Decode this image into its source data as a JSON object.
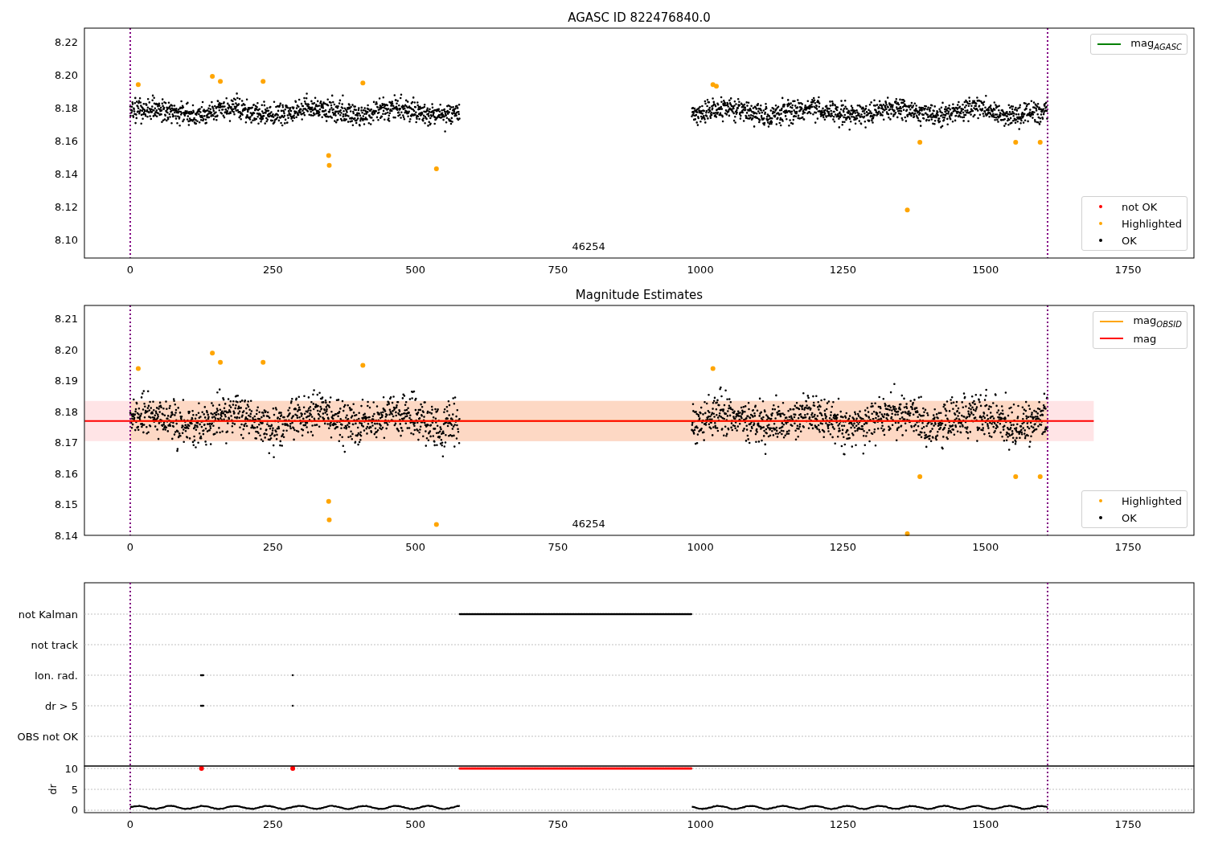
{
  "figure": {
    "panels": [
      {
        "title": "AGASC ID 822476840.0",
        "legends": [
          {
            "entries": [
              {
                "kind": "line",
                "label": "mag$_{AGASC}$",
                "color": "#008000"
              }
            ]
          },
          {
            "entries": [
              {
                "kind": "dot",
                "label": "not OK",
                "color": "#ff0000"
              },
              {
                "kind": "dot",
                "label": "Highlighted",
                "color": "#ffa500"
              },
              {
                "kind": "dot",
                "label": "OK",
                "color": "#000000"
              }
            ]
          }
        ],
        "chart_data": {
          "type": "scatter",
          "xlim": [
            -80.4,
            1865.7
          ],
          "ylim": [
            8.0888,
            8.2283
          ],
          "xticks": [
            0,
            250,
            500,
            750,
            1000,
            1250,
            1500,
            1750
          ],
          "yticks": [
            {
              "value": 8.1,
              "label": "8.10"
            },
            {
              "value": 8.12,
              "label": "8.12"
            },
            {
              "value": 8.14,
              "label": "8.14"
            },
            {
              "value": 8.16,
              "label": "8.16"
            },
            {
              "value": 8.18,
              "label": "8.18"
            },
            {
              "value": 8.2,
              "label": "8.20"
            },
            {
              "value": 8.22,
              "label": "8.22"
            }
          ],
          "x": [
            14,
            144,
            158,
            233,
            348,
            349,
            408,
            537,
            1022,
            1028,
            1363,
            1385,
            1553,
            1596
          ],
          "series": [
            {
              "color": "#ffa500",
              "values": [
                8.194,
                8.199,
                8.196,
                8.196,
                8.151,
                8.145,
                8.195,
                8.143,
                8.194,
                8.193,
                8.118,
                8.159,
                8.159,
                8.159
              ]
            }
          ],
          "ref_lines": [
            {
              "axis": "x",
              "value": 0,
              "color": "#800080"
            },
            {
              "axis": "x",
              "value": 1609,
              "color": "#800080"
            }
          ],
          "annotations": [
            "46254"
          ]
        }
      },
      {
        "title": "Magnitude Estimates",
        "legends": [
          {
            "entries": [
              {
                "kind": "line",
                "label": "mag$_{OBSID}$",
                "color": "#ffa500"
              },
              {
                "kind": "line",
                "label": "mag",
                "color": "#ff0000"
              }
            ]
          },
          {
            "entries": [
              {
                "kind": "dot",
                "label": "Highlighted",
                "color": "#ffa500"
              },
              {
                "kind": "dot",
                "label": "OK",
                "color": "#000000"
              }
            ]
          }
        ],
        "chart_data": {
          "type": "scatter",
          "xlim": [
            -80.4,
            1865.7
          ],
          "ylim": [
            8.14,
            8.2144
          ],
          "xticks": [
            0,
            250,
            500,
            750,
            1000,
            1250,
            1500,
            1750
          ],
          "yticks": [
            {
              "value": 8.14,
              "label": "8.14"
            },
            {
              "value": 8.15,
              "label": "8.15"
            },
            {
              "value": 8.16,
              "label": "8.16"
            },
            {
              "value": 8.17,
              "label": "8.17"
            },
            {
              "value": 8.18,
              "label": "8.18"
            },
            {
              "value": 8.19,
              "label": "8.19"
            },
            {
              "value": 8.2,
              "label": "8.20"
            },
            {
              "value": 8.21,
              "label": "8.21"
            }
          ],
          "x": [
            14,
            144,
            158,
            233,
            348,
            349,
            408,
            537,
            1022,
            1363,
            1385,
            1553,
            1596
          ],
          "series": [
            {
              "color": "#ffa500",
              "values": [
                8.194,
                8.199,
                8.196,
                8.196,
                8.151,
                8.145,
                8.195,
                8.1435,
                8.194,
                8.1405,
                8.159,
                8.159,
                8.159
              ]
            }
          ],
          "bands": [
            {
              "axis": "y",
              "from": 8.1705,
              "to": 8.1835,
              "color": "#ffe4e6"
            },
            {
              "axis": "y",
              "from": 8.1705,
              "to": 8.1835,
              "color": "#fdd8c4"
            }
          ],
          "ref_lines": [
            {
              "axis": "y",
              "value": 8.177,
              "color": "#ffa500"
            },
            {
              "axis": "y",
              "value": 8.177,
              "color": "#ff0000"
            },
            {
              "axis": "x",
              "value": 0,
              "color": "#800080"
            },
            {
              "axis": "x",
              "value": 1609,
              "color": "#800080"
            }
          ],
          "annotations": [
            "46254"
          ]
        }
      },
      {
        "flag_rows": [
          "not Kalman",
          "not track",
          "Ion. rad.",
          "dr > 5",
          "OBS not OK"
        ],
        "chart_data": {
          "type": "scatter",
          "ylabel": "dr",
          "xlim": [
            -80.4,
            1865.7
          ],
          "ylim": [
            -0.58,
            10.58
          ],
          "grid": true,
          "xticks": [
            0,
            250,
            500,
            750,
            1000,
            1250,
            1500,
            1750
          ],
          "yticks": [
            0,
            5,
            10
          ],
          "x": [
            125,
            285
          ],
          "series": [
            {
              "color": "#ff0000",
              "values": [
                10,
                10
              ]
            }
          ],
          "ref_lines": [
            {
              "axis": "x",
              "value": 0,
              "color": "#800080"
            },
            {
              "axis": "x",
              "value": 1609,
              "color": "#800080"
            }
          ]
        }
      }
    ]
  }
}
